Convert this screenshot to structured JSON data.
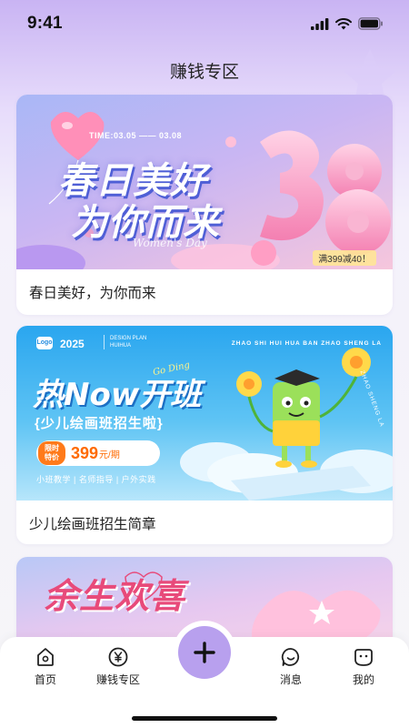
{
  "status_bar": {
    "time": "9:41"
  },
  "header": {
    "title": "赚钱专区"
  },
  "cards": [
    {
      "caption": "春日美好，为你而来",
      "banner": {
        "time_range": "TIME:03.05 —— 03.08",
        "title_line1": "春日美好",
        "title_line2": "为你而来",
        "script_text": "Women's Day",
        "promo": "满399减40！",
        "big_number": "38"
      }
    },
    {
      "caption": "少儿绘画班招生简章",
      "banner": {
        "logo": "Logo",
        "year": "2025",
        "mini_text": "DESIGN PLAN HUIHUA",
        "top_right": "ZHAO SHI HUI HUA BAN ZHAO SHENG LA",
        "headline": "热Now开班",
        "go_ding": "Go Ding",
        "subtitle": "{少儿绘画班招生啦}",
        "price_tag": "限时特价",
        "price": "399",
        "price_unit": "元/期",
        "features": "小班教学 | 名师指导 | 户外实践",
        "side_text": "ZHAO SHENG LA"
      }
    },
    {
      "caption": "",
      "banner": {
        "title": "余生欢喜"
      }
    }
  ],
  "tabbar": {
    "items": [
      {
        "label": "首页",
        "icon": "home-icon"
      },
      {
        "label": "赚钱专区",
        "icon": "yen-coin-icon"
      },
      {
        "label": "消息",
        "icon": "smile-message-icon"
      },
      {
        "label": "我的",
        "icon": "profile-face-icon"
      }
    ],
    "fab_icon": "plus-icon"
  },
  "colors": {
    "accent": "#b8a0ee",
    "header_gradient_top": "#c9b4f3",
    "orange": "#ff6a00",
    "pink": "#e84a7a"
  }
}
